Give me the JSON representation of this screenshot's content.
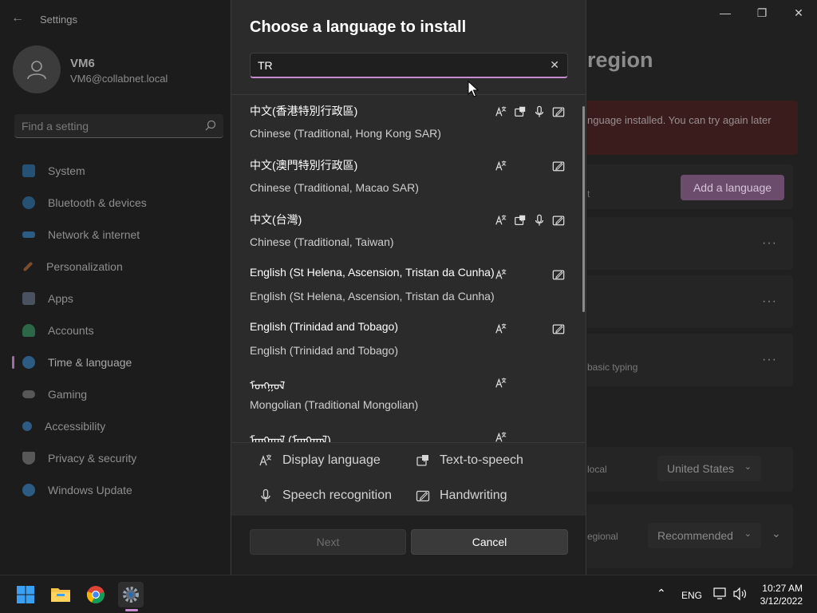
{
  "settings": {
    "title": "Settings",
    "user": {
      "name": "VM6",
      "email": "VM6@collabnet.local"
    },
    "search_placeholder": "Find a setting",
    "nav": [
      {
        "label": "System",
        "color": "#2d7dbd"
      },
      {
        "label": "Bluetooth & devices",
        "color": "#2d7dbd"
      },
      {
        "label": "Network & internet",
        "color": "#3b8fd9"
      },
      {
        "label": "Personalization",
        "color": "#c9743a"
      },
      {
        "label": "Apps",
        "color": "#6f7f95"
      },
      {
        "label": "Accounts",
        "color": "#3aa86b"
      },
      {
        "label": "Time & language",
        "color": "#3b8fd9"
      },
      {
        "label": "Gaming",
        "color": "#8a8a8a"
      },
      {
        "label": "Accessibility",
        "color": "#3b8fd9"
      },
      {
        "label": "Privacy & security",
        "color": "#8a8a8a"
      },
      {
        "label": "Windows Update",
        "color": "#3b8fd9"
      }
    ],
    "page_title_fragment": "region",
    "error_fragment": "nguage installed. You can try again later",
    "add_language_label": "Add a language",
    "text_fragment_t": "t",
    "basic_typing_fragment": "basic typing",
    "local_fragment": "local",
    "country_value": "United States",
    "regional_fragment": "egional",
    "regional_format_value": "Recommended"
  },
  "dialog": {
    "title": "Choose a language to install",
    "search_value": "TR",
    "languages": [
      {
        "native": "中文(香港特別行政區)",
        "english": "Chinese (Traditional, Hong Kong SAR)",
        "caps": [
          "display",
          "tts",
          "speech",
          "handwriting"
        ]
      },
      {
        "native": "中文(澳門特別行政區)",
        "english": "Chinese (Traditional, Macao SAR)",
        "caps": [
          "display",
          "handwriting"
        ]
      },
      {
        "native": "中文(台灣)",
        "english": "Chinese (Traditional, Taiwan)",
        "caps": [
          "display",
          "tts",
          "speech",
          "handwriting"
        ]
      },
      {
        "native": "English (St Helena, Ascension, Tristan da Cunha)",
        "english": "English (St Helena, Ascension, Tristan da Cunha)",
        "caps": [
          "display",
          "handwriting"
        ]
      },
      {
        "native": "English (Trinidad and Tobago)",
        "english": "English (Trinidad and Tobago)",
        "caps": [
          "display",
          "handwriting"
        ]
      },
      {
        "native": "ᠮᠣᠩᠭᠣᠯ",
        "english": "Mongolian (Traditional Mongolian)",
        "caps": [
          "display"
        ]
      },
      {
        "native": "ᠮᠣᠩᠭᠣᠯ (ᠮᠣᠩᠭᠣᠯ)",
        "english": "",
        "caps": [
          "display"
        ]
      }
    ],
    "legend": {
      "display": "Display language",
      "tts": "Text-to-speech",
      "speech": "Speech recognition",
      "handwriting": "Handwriting"
    },
    "next_label": "Next",
    "cancel_label": "Cancel"
  },
  "taskbar": {
    "language": "ENG",
    "time": "10:27 AM",
    "date": "3/12/2022"
  }
}
